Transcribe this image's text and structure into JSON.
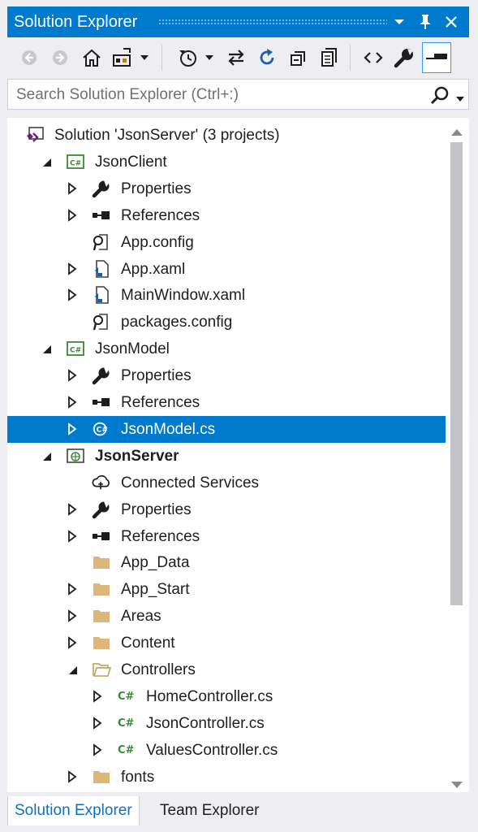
{
  "window": {
    "title": "Solution Explorer",
    "accent_color": "#007acc",
    "buttons": [
      {
        "name": "dropdown-arrow-icon"
      },
      {
        "name": "pin-icon"
      },
      {
        "name": "close-icon"
      }
    ]
  },
  "toolbar": {
    "tools": [
      {
        "icon": "back-icon",
        "enabled": false
      },
      {
        "icon": "forward-icon",
        "enabled": false
      },
      {
        "icon": "home-icon",
        "enabled": true
      },
      {
        "icon": "switch-views-icon",
        "enabled": true
      },
      {
        "icon": "pending-changes-filter-icon",
        "enabled": true
      },
      {
        "icon": "sync-active-document-icon",
        "enabled": true
      },
      {
        "icon": "refresh-icon",
        "enabled": true
      },
      {
        "icon": "collapse-all-icon",
        "enabled": true
      },
      {
        "icon": "show-all-files-icon",
        "enabled": true
      },
      {
        "icon": "view-code-icon",
        "enabled": true
      },
      {
        "icon": "properties-wrench-icon",
        "enabled": true
      },
      {
        "icon": "preview-selected-items-icon",
        "enabled": true,
        "active": true
      }
    ]
  },
  "search": {
    "placeholder": "Search Solution Explorer (Ctrl+:)"
  },
  "tree": {
    "items": [
      {
        "label": "Solution 'JsonServer' (3 projects)",
        "icon": "solution-icon",
        "level": 0,
        "expander": "none"
      },
      {
        "label": "JsonClient",
        "icon": "csharp-project-icon",
        "level": 1,
        "expander": "expanded"
      },
      {
        "label": "Properties",
        "icon": "wrench-icon",
        "level": 2,
        "expander": "collapsed"
      },
      {
        "label": "References",
        "icon": "references-icon",
        "level": 2,
        "expander": "collapsed"
      },
      {
        "label": "App.config",
        "icon": "config-file-icon",
        "level": 2,
        "expander": "none"
      },
      {
        "label": "App.xaml",
        "icon": "xaml-file-icon",
        "level": 2,
        "expander": "collapsed"
      },
      {
        "label": "MainWindow.xaml",
        "icon": "xaml-file-icon",
        "level": 2,
        "expander": "collapsed"
      },
      {
        "label": "packages.config",
        "icon": "config-file-icon",
        "level": 2,
        "expander": "none"
      },
      {
        "label": "JsonModel",
        "icon": "csharp-project-icon",
        "level": 1,
        "expander": "expanded"
      },
      {
        "label": "Properties",
        "icon": "wrench-icon",
        "level": 2,
        "expander": "collapsed"
      },
      {
        "label": "References",
        "icon": "references-icon",
        "level": 2,
        "expander": "collapsed"
      },
      {
        "label": "JsonModel.cs",
        "icon": "csharp-file-icon",
        "level": 2,
        "expander": "collapsed",
        "selected": true
      },
      {
        "label": "JsonServer",
        "icon": "web-project-icon",
        "level": 1,
        "expander": "expanded",
        "bold": true
      },
      {
        "label": "Connected Services",
        "icon": "connected-services-icon",
        "level": 2,
        "expander": "none"
      },
      {
        "label": "Properties",
        "icon": "wrench-icon",
        "level": 2,
        "expander": "collapsed"
      },
      {
        "label": "References",
        "icon": "references-icon",
        "level": 2,
        "expander": "collapsed"
      },
      {
        "label": "App_Data",
        "icon": "folder-icon",
        "level": 2,
        "expander": "none"
      },
      {
        "label": "App_Start",
        "icon": "folder-icon",
        "level": 2,
        "expander": "collapsed"
      },
      {
        "label": "Areas",
        "icon": "folder-icon",
        "level": 2,
        "expander": "collapsed"
      },
      {
        "label": "Content",
        "icon": "folder-icon",
        "level": 2,
        "expander": "collapsed"
      },
      {
        "label": "Controllers",
        "icon": "open-folder-icon",
        "level": 2,
        "expander": "expanded"
      },
      {
        "label": "HomeController.cs",
        "icon": "csharp-code-icon",
        "level": 3,
        "expander": "collapsed"
      },
      {
        "label": "JsonController.cs",
        "icon": "csharp-code-icon",
        "level": 3,
        "expander": "collapsed"
      },
      {
        "label": "ValuesController.cs",
        "icon": "csharp-code-icon",
        "level": 3,
        "expander": "collapsed"
      },
      {
        "label": "fonts",
        "icon": "folder-icon",
        "level": 2,
        "expander": "collapsed"
      }
    ]
  },
  "tabs": [
    {
      "label": "Solution Explorer",
      "active": true
    },
    {
      "label": "Team Explorer",
      "active": false
    }
  ]
}
